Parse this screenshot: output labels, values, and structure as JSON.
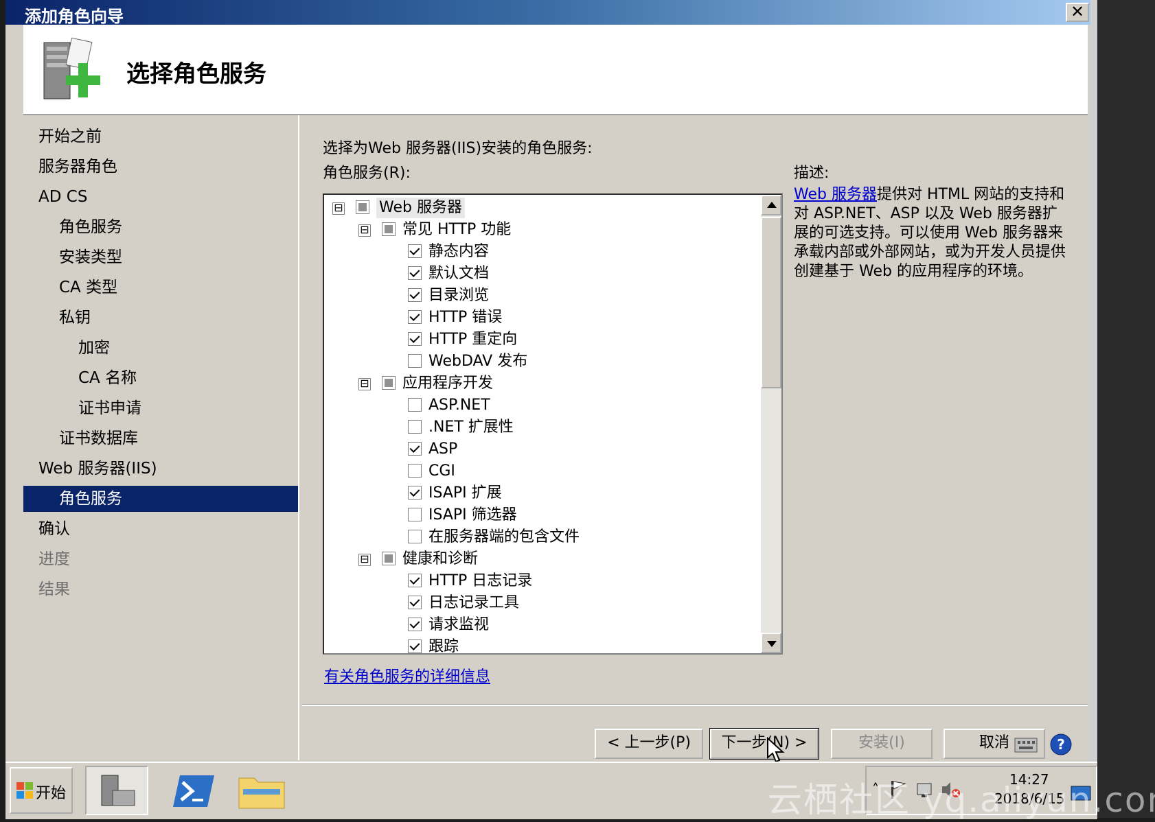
{
  "window": {
    "title": "添加角色向导",
    "close_glyph": "✕"
  },
  "header": {
    "title": "选择角色服务",
    "icon": "server-add-icon"
  },
  "nav": [
    {
      "label": "开始之前",
      "state": "normal"
    },
    {
      "label": "服务器角色",
      "state": "normal"
    },
    {
      "label": "AD CS",
      "state": "normal"
    },
    {
      "label": "角色服务",
      "state": "normal"
    },
    {
      "label": "安装类型",
      "state": "normal"
    },
    {
      "label": "CA 类型",
      "state": "normal"
    },
    {
      "label": "私钥",
      "state": "normal"
    },
    {
      "label": "加密",
      "state": "normal"
    },
    {
      "label": "CA 名称",
      "state": "normal"
    },
    {
      "label": "证书申请",
      "state": "normal"
    },
    {
      "label": "证书数据库",
      "state": "normal"
    },
    {
      "label": "Web 服务器(IIS)",
      "state": "normal"
    },
    {
      "label": "角色服务",
      "state": "selected"
    },
    {
      "label": "确认",
      "state": "normal"
    },
    {
      "label": "进度",
      "state": "disabled"
    },
    {
      "label": "结果",
      "state": "disabled"
    }
  ],
  "main": {
    "intro": "选择为Web 服务器(IIS)安装的角色服务:",
    "list_label": "角色服务(R):",
    "desc_label": "描述:",
    "more_link": "有关角色服务的详细信息"
  },
  "tree": [
    {
      "label": "Web 服务器",
      "state": "partial",
      "expander": "⊟"
    },
    {
      "label": "常见 HTTP 功能",
      "state": "partial",
      "expander": "⊟"
    },
    {
      "label": "静态内容",
      "state": "checked"
    },
    {
      "label": "默认文档",
      "state": "checked"
    },
    {
      "label": "目录浏览",
      "state": "checked"
    },
    {
      "label": "HTTP 错误",
      "state": "checked"
    },
    {
      "label": "HTTP 重定向",
      "state": "checked"
    },
    {
      "label": "WebDAV 发布",
      "state": "unchecked"
    },
    {
      "label": "应用程序开发",
      "state": "partial",
      "expander": "⊟"
    },
    {
      "label": "ASP.NET",
      "state": "unchecked"
    },
    {
      "label": ".NET 扩展性",
      "state": "unchecked"
    },
    {
      "label": "ASP",
      "state": "checked"
    },
    {
      "label": "CGI",
      "state": "unchecked"
    },
    {
      "label": "ISAPI 扩展",
      "state": "checked"
    },
    {
      "label": "ISAPI 筛选器",
      "state": "unchecked"
    },
    {
      "label": "在服务器端的包含文件",
      "state": "unchecked"
    },
    {
      "label": "健康和诊断",
      "state": "partial",
      "expander": "⊟"
    },
    {
      "label": "HTTP 日志记录",
      "state": "checked"
    },
    {
      "label": "日志记录工具",
      "state": "checked"
    },
    {
      "label": "请求监视",
      "state": "checked"
    },
    {
      "label": "跟踪",
      "state": "checked"
    }
  ],
  "description": {
    "link": "Web 服务器",
    "text": "提供对 HTML 网站的支持和对 ASP.NET、ASP 以及 Web 服务器扩展的可选支持。可以使用 Web 服务器来承载内部或外部网站，或为开发人员提供创建基于 Web 的应用程序的环境。"
  },
  "buttons": {
    "back": "< 上一步(P)",
    "next": "下一步(N) >",
    "install": "安装(I)",
    "cancel": "取消"
  },
  "taskbar": {
    "start": "开始",
    "clock_time": "14:27",
    "clock_date": "2018/6/15",
    "watermark": "云栖社区 yq.aliyun.com"
  }
}
